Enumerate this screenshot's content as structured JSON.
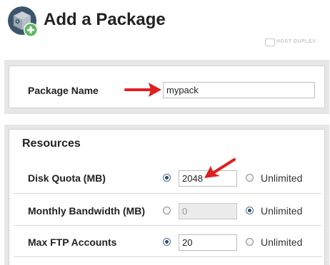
{
  "page": {
    "title": "Add a Package",
    "brand": "HOST DUPLEX"
  },
  "package": {
    "label": "Package Name",
    "value": "mypack"
  },
  "resources": {
    "title": "Resources",
    "unlimited_label": "Unlimited",
    "rows": [
      {
        "label": "Disk Quota (MB)",
        "value": "2048",
        "selected": "value"
      },
      {
        "label": "Monthly Bandwidth (MB)",
        "value": "0",
        "selected": "unlimited"
      },
      {
        "label": "Max FTP Accounts",
        "value": "20",
        "selected": "value"
      }
    ]
  },
  "colors": {
    "annotation_arrow": "#e02020",
    "panel_bg": "#e6e6e6",
    "radio_checked": "#2d4d6e"
  },
  "icons": {
    "package": "package-add-icon",
    "brand": "host-duplex-logo-icon",
    "annotation": "red-arrow-icon"
  }
}
